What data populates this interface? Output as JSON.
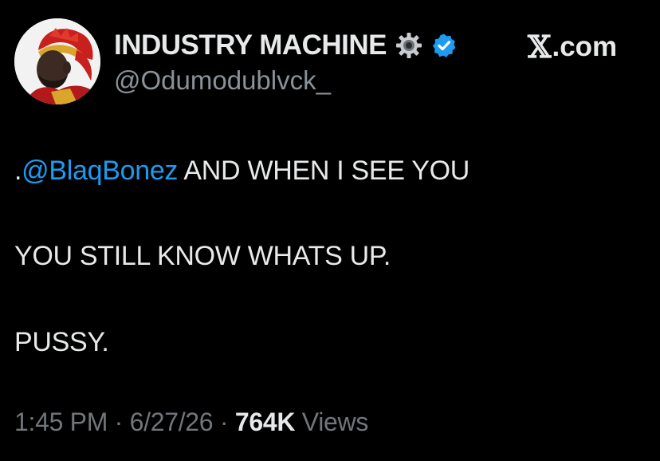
{
  "author": {
    "display_name": "INDUSTRY MACHINE",
    "handle": "@Odumodublvck_",
    "avatar_icon": "profile-photo-man-in-gold-red-crown",
    "badges": [
      "gear-icon",
      "verified-icon"
    ]
  },
  "site": {
    "label": "X.com",
    "x_glyph": "𝕏",
    "suffix": ".com"
  },
  "tweet": {
    "mention_prefix": ".",
    "mention": "@BlaqBonez",
    "line_1_rest": " AND WHEN I SEE YOU",
    "line_2": "YOU STILL KNOW WHATS UP.",
    "line_3": "PUSSY."
  },
  "meta": {
    "time": "1:45 PM",
    "separator": " · ",
    "date": "6/27/26",
    "views_count": "764K",
    "views_label": " Views"
  },
  "colors": {
    "background": "#000000",
    "text": "#e7e9ea",
    "muted": "#71767b",
    "handle": "#8b9198",
    "link": "#1d9bf0",
    "verified": "#1d9bf0"
  }
}
